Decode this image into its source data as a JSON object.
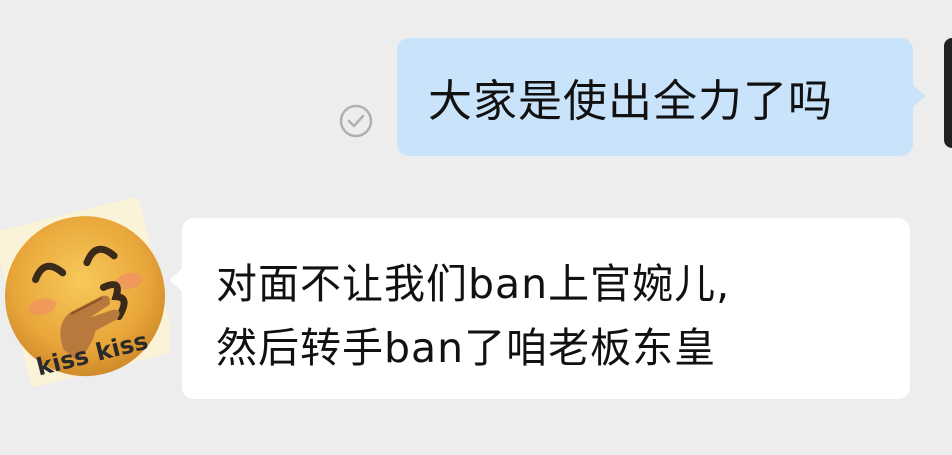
{
  "chat": {
    "sent_message": {
      "text": "大家是使出全力了吗",
      "status": "read"
    },
    "received_message": {
      "lines": [
        "对面不让我们ban上官婉儿,",
        "然后转手ban了咱老板东皇"
      ],
      "avatar": {
        "sticker_text": "kiss kiss",
        "icon": "kiss-emoji-avatar"
      }
    }
  },
  "colors": {
    "background": "#ededed",
    "sent_bubble": "#c9e3fb",
    "received_bubble": "#ffffff",
    "text": "#111111"
  }
}
